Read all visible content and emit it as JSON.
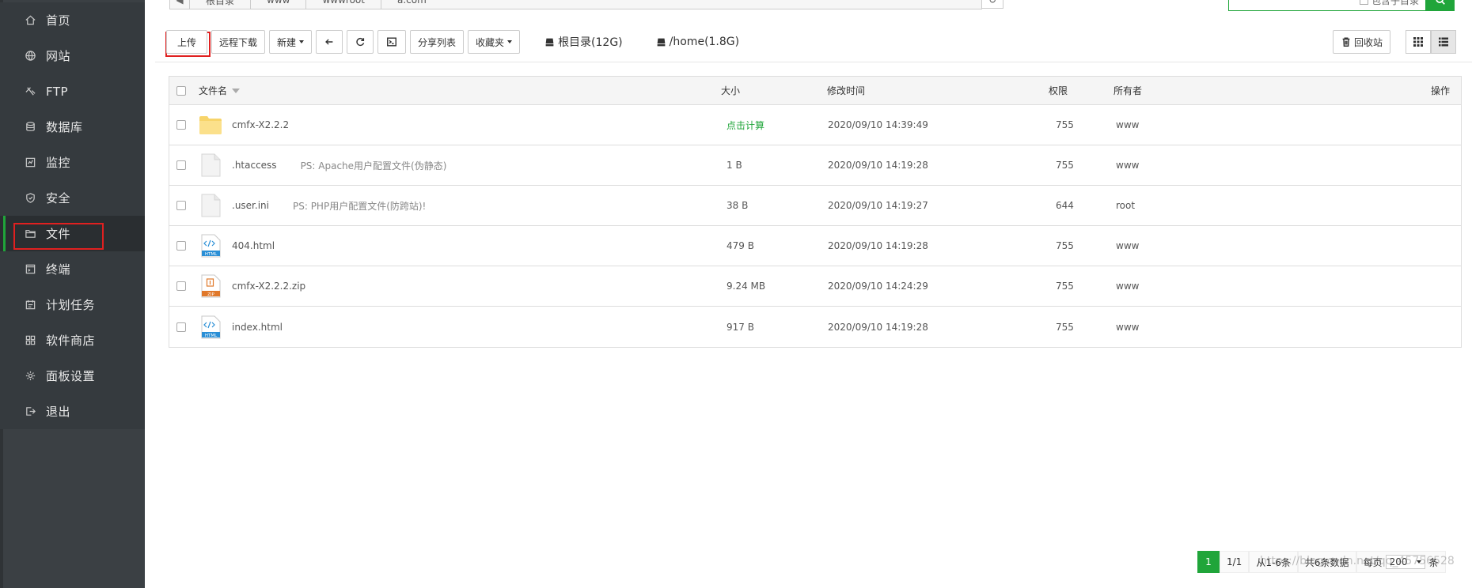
{
  "sidebar": {
    "items": [
      {
        "label": "首页",
        "icon": "home-icon"
      },
      {
        "label": "网站",
        "icon": "globe-icon"
      },
      {
        "label": "FTP",
        "icon": "ftp-icon"
      },
      {
        "label": "数据库",
        "icon": "database-icon"
      },
      {
        "label": "监控",
        "icon": "monitor-icon"
      },
      {
        "label": "安全",
        "icon": "shield-icon"
      },
      {
        "label": "文件",
        "icon": "folder-icon",
        "active": true
      },
      {
        "label": "终端",
        "icon": "terminal-icon"
      },
      {
        "label": "计划任务",
        "icon": "calendar-icon"
      },
      {
        "label": "软件商店",
        "icon": "grid-icon"
      },
      {
        "label": "面板设置",
        "icon": "gear-icon"
      },
      {
        "label": "退出",
        "icon": "logout-icon"
      }
    ]
  },
  "path": {
    "crumbs": [
      "根目录",
      "www",
      "wwwroot",
      "a.com"
    ]
  },
  "search": {
    "include_subdir_label": "包含子目录"
  },
  "toolbar": {
    "upload": "上传",
    "remote_download": "远程下载",
    "new": "新建",
    "share_list": "分享列表",
    "favorites": "收藏夹",
    "disk_root": "根目录(12G)",
    "disk_home": "/home(1.8G)",
    "recycle_bin": "回收站"
  },
  "table": {
    "headers": {
      "name": "文件名",
      "size": "大小",
      "mtime": "修改时间",
      "perm": "权限",
      "owner": "所有者",
      "op": "操作"
    },
    "rows": [
      {
        "name": "cmfx-X2.2.2",
        "type": "folder",
        "ps": "",
        "size": "点击计算",
        "mtime": "2020/09/10 14:39:49",
        "perm": "755",
        "owner": "www"
      },
      {
        "name": ".htaccess",
        "type": "file",
        "ps": "PS: Apache用户配置文件(伪静态)",
        "size": "1 B",
        "mtime": "2020/09/10 14:19:28",
        "perm": "755",
        "owner": "www"
      },
      {
        "name": ".user.ini",
        "type": "file",
        "ps": "PS: PHP用户配置文件(防跨站)!",
        "size": "38 B",
        "mtime": "2020/09/10 14:19:27",
        "perm": "644",
        "owner": "root"
      },
      {
        "name": "404.html",
        "type": "html",
        "ps": "",
        "size": "479 B",
        "mtime": "2020/09/10 14:19:28",
        "perm": "755",
        "owner": "www"
      },
      {
        "name": "cmfx-X2.2.2.zip",
        "type": "zip",
        "ps": "",
        "size": "9.24 MB",
        "mtime": "2020/09/10 14:24:29",
        "perm": "755",
        "owner": "www"
      },
      {
        "name": "index.html",
        "type": "html",
        "ps": "",
        "size": "917 B",
        "mtime": "2020/09/10 14:19:28",
        "perm": "755",
        "owner": "www"
      }
    ]
  },
  "pager": {
    "current": "1",
    "pages": "1/1",
    "range": "从1-6条",
    "total": "共6条数据",
    "per_page_label": "每页",
    "per_page_value": "200",
    "unit": "条"
  },
  "watermark": "https://blog.csdn.net/qq_45756528",
  "colors": {
    "sidebar_bg": "#3b4044",
    "accent": "#20a53a",
    "highlight": "#e02020"
  }
}
